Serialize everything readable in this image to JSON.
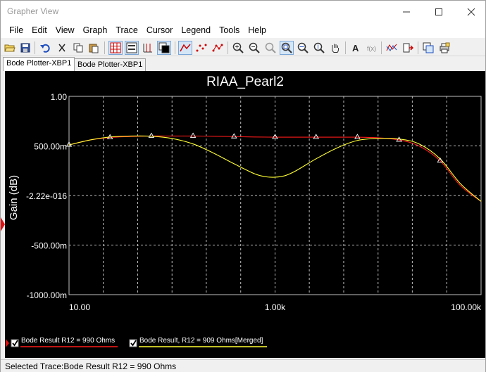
{
  "window": {
    "title": "Grapher View"
  },
  "menu": [
    "File",
    "Edit",
    "View",
    "Graph",
    "Trace",
    "Cursor",
    "Legend",
    "Tools",
    "Help"
  ],
  "tabs": [
    {
      "label": "Bode Plotter-XBP1",
      "active": true
    },
    {
      "label": "Bode Plotter-XBP1",
      "active": false
    }
  ],
  "toolbar": {
    "icons": [
      "open-icon",
      "save-icon",
      "undo-icon",
      "cut-icon",
      "copy-icon",
      "paste-icon",
      "grid-icon",
      "legend-icon",
      "cursors-icon",
      "reverse-colors-icon",
      "lines-icon",
      "dots-icon",
      "dots-lines-icon",
      "zoom-in-icon",
      "zoom-out-icon",
      "zoom-area-icon",
      "zoom-full-icon",
      "zoom-x-icon",
      "zoom-y-icon",
      "pan-icon",
      "text-icon",
      "math-icon",
      "export-icon",
      "properties-icon",
      "overlay-icon",
      "print-icon"
    ]
  },
  "status": {
    "text": "Selected Trace:Bode Result R12 = 990 Ohms"
  },
  "colors": {
    "plot_bg": "#000000",
    "grid": "#bfbfbf",
    "trace1": "#ff1a1a",
    "trace2": "#ffff33",
    "text": "#ffffff"
  },
  "chart_data": {
    "type": "line",
    "title": "RIAA_Pearl2",
    "xlabel": "",
    "ylabel": "Gain (dB)",
    "xscale": "log",
    "xlim": [
      10,
      100000
    ],
    "ylim": [
      -1.0,
      1.0
    ],
    "grid": true,
    "y_tick_labels": [
      "1.00",
      "500.00m",
      "-2.22e-016",
      "-500.00m",
      "-1000.00m"
    ],
    "y_tick_values": [
      1.0,
      0.5,
      0.0,
      -0.5,
      -1.0
    ],
    "x_tick_labels": [
      "10.00",
      "1.00k",
      "100.00k"
    ],
    "x_tick_values": [
      10,
      1000,
      100000
    ],
    "series": [
      {
        "name": "Bode Result R12 = 990 Ohms",
        "color": "#ff1a1a",
        "marker": "triangle",
        "x": [
          10,
          16,
          25,
          40,
          63,
          100,
          160,
          250,
          400,
          630,
          1000,
          1600,
          2500,
          4000,
          6300,
          10000,
          16000,
          25000,
          40000,
          63000,
          100000
        ],
        "y": [
          0.51,
          0.56,
          0.585,
          0.595,
          0.6,
          0.6,
          0.6,
          0.598,
          0.594,
          0.59,
          0.588,
          0.588,
          0.588,
          0.588,
          0.588,
          0.582,
          0.56,
          0.5,
          0.35,
          0.1,
          -0.06
        ]
      },
      {
        "name": "Bode Result, R12 = 909 Ohms[Merged]",
        "color": "#ffff33",
        "marker": "none",
        "x": [
          10,
          16,
          25,
          40,
          63,
          100,
          160,
          250,
          400,
          630,
          800,
          1000,
          1250,
          1600,
          2500,
          4000,
          6300,
          10000,
          16000,
          25000,
          40000,
          63000,
          100000
        ],
        "y": [
          0.51,
          0.56,
          0.59,
          0.6,
          0.598,
          0.575,
          0.52,
          0.43,
          0.32,
          0.22,
          0.19,
          0.185,
          0.2,
          0.25,
          0.37,
          0.48,
          0.555,
          0.575,
          0.57,
          0.52,
          0.37,
          0.12,
          -0.06
        ]
      }
    ],
    "legend_placement": "bottom-left",
    "legend": [
      "Bode Result R12 = 990 Ohms",
      "Bode Result, R12 = 909 Ohms[Merged]"
    ]
  }
}
